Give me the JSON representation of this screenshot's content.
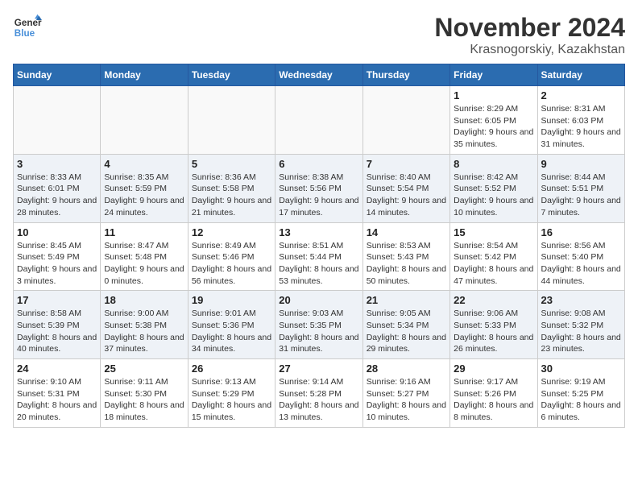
{
  "logo": {
    "line1": "General",
    "line2": "Blue"
  },
  "title": "November 2024",
  "location": "Krasnogorskiy, Kazakhstan",
  "days_of_week": [
    "Sunday",
    "Monday",
    "Tuesday",
    "Wednesday",
    "Thursday",
    "Friday",
    "Saturday"
  ],
  "weeks": [
    [
      {
        "day": "",
        "info": ""
      },
      {
        "day": "",
        "info": ""
      },
      {
        "day": "",
        "info": ""
      },
      {
        "day": "",
        "info": ""
      },
      {
        "day": "",
        "info": ""
      },
      {
        "day": "1",
        "info": "Sunrise: 8:29 AM\nSunset: 6:05 PM\nDaylight: 9 hours and 35 minutes."
      },
      {
        "day": "2",
        "info": "Sunrise: 8:31 AM\nSunset: 6:03 PM\nDaylight: 9 hours and 31 minutes."
      }
    ],
    [
      {
        "day": "3",
        "info": "Sunrise: 8:33 AM\nSunset: 6:01 PM\nDaylight: 9 hours and 28 minutes."
      },
      {
        "day": "4",
        "info": "Sunrise: 8:35 AM\nSunset: 5:59 PM\nDaylight: 9 hours and 24 minutes."
      },
      {
        "day": "5",
        "info": "Sunrise: 8:36 AM\nSunset: 5:58 PM\nDaylight: 9 hours and 21 minutes."
      },
      {
        "day": "6",
        "info": "Sunrise: 8:38 AM\nSunset: 5:56 PM\nDaylight: 9 hours and 17 minutes."
      },
      {
        "day": "7",
        "info": "Sunrise: 8:40 AM\nSunset: 5:54 PM\nDaylight: 9 hours and 14 minutes."
      },
      {
        "day": "8",
        "info": "Sunrise: 8:42 AM\nSunset: 5:52 PM\nDaylight: 9 hours and 10 minutes."
      },
      {
        "day": "9",
        "info": "Sunrise: 8:44 AM\nSunset: 5:51 PM\nDaylight: 9 hours and 7 minutes."
      }
    ],
    [
      {
        "day": "10",
        "info": "Sunrise: 8:45 AM\nSunset: 5:49 PM\nDaylight: 9 hours and 3 minutes."
      },
      {
        "day": "11",
        "info": "Sunrise: 8:47 AM\nSunset: 5:48 PM\nDaylight: 9 hours and 0 minutes."
      },
      {
        "day": "12",
        "info": "Sunrise: 8:49 AM\nSunset: 5:46 PM\nDaylight: 8 hours and 56 minutes."
      },
      {
        "day": "13",
        "info": "Sunrise: 8:51 AM\nSunset: 5:44 PM\nDaylight: 8 hours and 53 minutes."
      },
      {
        "day": "14",
        "info": "Sunrise: 8:53 AM\nSunset: 5:43 PM\nDaylight: 8 hours and 50 minutes."
      },
      {
        "day": "15",
        "info": "Sunrise: 8:54 AM\nSunset: 5:42 PM\nDaylight: 8 hours and 47 minutes."
      },
      {
        "day": "16",
        "info": "Sunrise: 8:56 AM\nSunset: 5:40 PM\nDaylight: 8 hours and 44 minutes."
      }
    ],
    [
      {
        "day": "17",
        "info": "Sunrise: 8:58 AM\nSunset: 5:39 PM\nDaylight: 8 hours and 40 minutes."
      },
      {
        "day": "18",
        "info": "Sunrise: 9:00 AM\nSunset: 5:38 PM\nDaylight: 8 hours and 37 minutes."
      },
      {
        "day": "19",
        "info": "Sunrise: 9:01 AM\nSunset: 5:36 PM\nDaylight: 8 hours and 34 minutes."
      },
      {
        "day": "20",
        "info": "Sunrise: 9:03 AM\nSunset: 5:35 PM\nDaylight: 8 hours and 31 minutes."
      },
      {
        "day": "21",
        "info": "Sunrise: 9:05 AM\nSunset: 5:34 PM\nDaylight: 8 hours and 29 minutes."
      },
      {
        "day": "22",
        "info": "Sunrise: 9:06 AM\nSunset: 5:33 PM\nDaylight: 8 hours and 26 minutes."
      },
      {
        "day": "23",
        "info": "Sunrise: 9:08 AM\nSunset: 5:32 PM\nDaylight: 8 hours and 23 minutes."
      }
    ],
    [
      {
        "day": "24",
        "info": "Sunrise: 9:10 AM\nSunset: 5:31 PM\nDaylight: 8 hours and 20 minutes."
      },
      {
        "day": "25",
        "info": "Sunrise: 9:11 AM\nSunset: 5:30 PM\nDaylight: 8 hours and 18 minutes."
      },
      {
        "day": "26",
        "info": "Sunrise: 9:13 AM\nSunset: 5:29 PM\nDaylight: 8 hours and 15 minutes."
      },
      {
        "day": "27",
        "info": "Sunrise: 9:14 AM\nSunset: 5:28 PM\nDaylight: 8 hours and 13 minutes."
      },
      {
        "day": "28",
        "info": "Sunrise: 9:16 AM\nSunset: 5:27 PM\nDaylight: 8 hours and 10 minutes."
      },
      {
        "day": "29",
        "info": "Sunrise: 9:17 AM\nSunset: 5:26 PM\nDaylight: 8 hours and 8 minutes."
      },
      {
        "day": "30",
        "info": "Sunrise: 9:19 AM\nSunset: 5:25 PM\nDaylight: 8 hours and 6 minutes."
      }
    ]
  ]
}
